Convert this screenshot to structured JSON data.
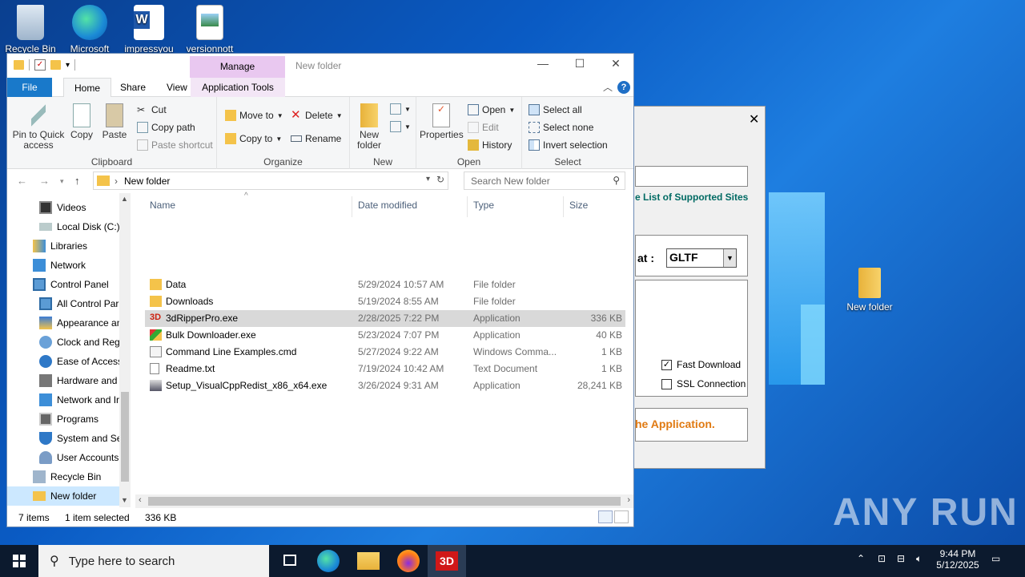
{
  "desktop": {
    "icons": [
      {
        "label": "Recycle Bin",
        "icon": "recycle-bin-icon"
      },
      {
        "label": "Microsoft",
        "icon": "edge-icon"
      },
      {
        "label": "impressyou",
        "icon": "word-doc-icon"
      },
      {
        "label": "versionnott",
        "icon": "image-file-icon"
      },
      {
        "label": "New folder",
        "icon": "folder-icon"
      }
    ]
  },
  "bg_dialog": {
    "link": "e List of Supported Sites",
    "format_label": "at :",
    "format_value": "GLTF",
    "fast_download": "Fast Download",
    "ssl_connection": "SSL Connection",
    "footer": "he Application."
  },
  "explorer": {
    "title": "New folder",
    "manage_tab": "Manage",
    "tabs": {
      "file": "File",
      "home": "Home",
      "share": "Share",
      "view": "View",
      "app_tools": "Application Tools"
    },
    "ribbon": {
      "clipboard": {
        "label": "Clipboard",
        "pin": "Pin to Quick access",
        "copy": "Copy",
        "paste": "Paste",
        "cut": "Cut",
        "copy_path": "Copy path",
        "paste_shortcut": "Paste shortcut"
      },
      "organize": {
        "label": "Organize",
        "move_to": "Move to",
        "copy_to": "Copy to",
        "delete": "Delete",
        "rename": "Rename"
      },
      "new": {
        "label": "New",
        "new_folder": "New folder"
      },
      "open": {
        "label": "Open",
        "properties": "Properties",
        "open": "Open",
        "edit": "Edit",
        "history": "History"
      },
      "select": {
        "label": "Select",
        "select_all": "Select all",
        "select_none": "Select none",
        "invert": "Invert selection"
      }
    },
    "address": {
      "path": "New folder",
      "search_placeholder": "Search New folder"
    },
    "nav_items": [
      {
        "label": "Videos",
        "icon": "videos-icon"
      },
      {
        "label": "Local Disk (C:)",
        "icon": "drive-icon"
      },
      {
        "label": "Libraries",
        "icon": "libraries-icon"
      },
      {
        "label": "Network",
        "icon": "network-icon"
      },
      {
        "label": "Control Panel",
        "icon": "control-panel-icon"
      },
      {
        "label": "All Control Par",
        "icon": "control-panel-icon"
      },
      {
        "label": "Appearance an",
        "icon": "appearance-icon"
      },
      {
        "label": "Clock and Regi",
        "icon": "clock-icon"
      },
      {
        "label": "Ease of Access",
        "icon": "ease-access-icon"
      },
      {
        "label": "Hardware and",
        "icon": "hardware-icon"
      },
      {
        "label": "Network and Ir",
        "icon": "network-icon"
      },
      {
        "label": "Programs",
        "icon": "programs-icon"
      },
      {
        "label": "System and Se",
        "icon": "shield-icon"
      },
      {
        "label": "User Accounts",
        "icon": "users-icon"
      },
      {
        "label": "Recycle Bin",
        "icon": "recycle-bin-icon"
      },
      {
        "label": "New folder",
        "icon": "folder-icon"
      }
    ],
    "columns": {
      "name": "Name",
      "date": "Date modified",
      "type": "Type",
      "size": "Size"
    },
    "files": [
      {
        "name": "Data",
        "date": "5/29/2024 10:57 AM",
        "type": "File folder",
        "size": "",
        "icon": "folder-icon"
      },
      {
        "name": "Downloads",
        "date": "5/19/2024 8:55 AM",
        "type": "File folder",
        "size": "",
        "icon": "folder-icon"
      },
      {
        "name": "3dRipperPro.exe",
        "date": "2/28/2025 7:22 PM",
        "type": "Application",
        "size": "336 KB",
        "icon": "3d-app-icon"
      },
      {
        "name": "Bulk Downloader.exe",
        "date": "5/23/2024 7:07 PM",
        "type": "Application",
        "size": "40 KB",
        "icon": "app-icon"
      },
      {
        "name": "Command Line Examples.cmd",
        "date": "5/27/2024 9:22 AM",
        "type": "Windows Comma...",
        "size": "1 KB",
        "icon": "cmd-icon"
      },
      {
        "name": "Readme.txt",
        "date": "7/19/2024 10:42 AM",
        "type": "Text Document",
        "size": "1 KB",
        "icon": "text-icon"
      },
      {
        "name": "Setup_VisualCppRedist_x86_x64.exe",
        "date": "3/26/2024 9:31 AM",
        "type": "Application",
        "size": "28,241 KB",
        "icon": "installer-icon"
      }
    ],
    "status": {
      "count": "7 items",
      "selected": "1 item selected",
      "size": "336 KB"
    }
  },
  "taskbar": {
    "search_placeholder": "Type here to search",
    "time": "9:44 PM",
    "date": "5/12/2025"
  },
  "watermark": "ANY RUN",
  "colors": {
    "accent": "#1979ca",
    "manage": "#e9c8f0",
    "selection": "#cce8ff",
    "taskbar": "#0c1a2e"
  }
}
